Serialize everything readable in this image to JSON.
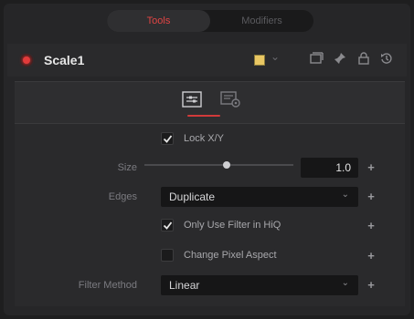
{
  "tabs": {
    "active_label": "Tools",
    "inactive_label": "Modifiers"
  },
  "header": {
    "node_name": "Scale1",
    "status_color": "#e23b3b",
    "swatch_color": "#e9c763",
    "chevron": "⌄",
    "icons": [
      "window-icon",
      "pin-icon",
      "lock-icon",
      "reset-icon"
    ]
  },
  "subtabs": {
    "icons": [
      "controls-icon",
      "settings-icon"
    ]
  },
  "controls": {
    "lock_xy": {
      "label": "Lock X/Y",
      "checked": true
    },
    "size": {
      "label": "Size",
      "value": "1.0",
      "slider_fraction": 0.55
    },
    "edges": {
      "label": "Edges",
      "value": "Duplicate",
      "chevron": "⌄"
    },
    "only_use_filter": {
      "label": "Only Use Filter in HiQ",
      "checked": true
    },
    "change_pixel_aspect": {
      "label": "Change Pixel Aspect",
      "checked": false
    },
    "filter_method": {
      "label": "Filter Method",
      "value": "Linear",
      "chevron": "⌄"
    },
    "plus_glyph": "+"
  },
  "colors": {
    "accent": "#d23a3a",
    "panel": "#2a2a2c",
    "field": "#161617"
  }
}
